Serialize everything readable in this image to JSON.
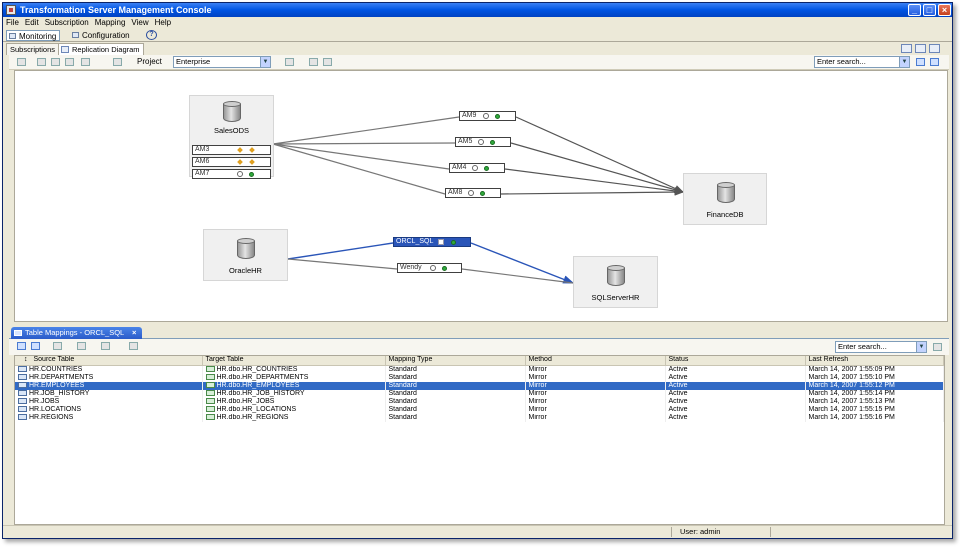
{
  "window": {
    "title": "Transformation Server Management Console"
  },
  "menu": [
    "File",
    "Edit",
    "Subscription",
    "Mapping",
    "View",
    "Help"
  ],
  "perspectives": [
    {
      "label": "Monitoring",
      "active": true
    },
    {
      "label": "Configuration",
      "active": false
    }
  ],
  "view_tabs": [
    {
      "label": "Subscriptions",
      "active": false
    },
    {
      "label": "Replication Diagram",
      "active": true
    }
  ],
  "toolbar": {
    "project_label": "Project",
    "project_value": "Enterprise",
    "search_placeholder": "Enter search..."
  },
  "diagram": {
    "nodes": [
      {
        "id": "salesods",
        "label": "SalesODS"
      },
      {
        "id": "financedb",
        "label": "FinanceDB"
      },
      {
        "id": "oraclehr",
        "label": "OracleHR"
      },
      {
        "id": "sqlserverhr",
        "label": "SQLServerHR"
      }
    ],
    "source_subscriptions": [
      "AM3",
      "AM6",
      "AM7"
    ],
    "route_subscriptions": [
      "AM9",
      "AM5",
      "AM4",
      "AM8",
      "ORCL_SQL",
      "Wendy"
    ],
    "selected_subscription": "ORCL_SQL"
  },
  "table_mappings": {
    "tab_label": "Table Mappings - ORCL_SQL",
    "search_placeholder": "Enter search...",
    "columns": [
      "Source Table",
      "Target Table",
      "Mapping Type",
      "Method",
      "Status",
      "Last Refresh"
    ],
    "rows": [
      [
        "HR.COUNTRIES",
        "HR.dbo.HR_COUNTRIES",
        "Standard",
        "Mirror",
        "Active",
        "March 14, 2007 1:55:09 PM"
      ],
      [
        "HR.DEPARTMENTS",
        "HR.dbo.HR_DEPARTMENTS",
        "Standard",
        "Mirror",
        "Active",
        "March 14, 2007 1:55:10 PM"
      ],
      [
        "HR.EMPLOYEES",
        "HR.dbo.HR_EMPLOYEES",
        "Standard",
        "Mirror",
        "Active",
        "March 14, 2007 1:55:12 PM"
      ],
      [
        "HR.JOB_HISTORY",
        "HR.dbo.HR_JOB_HISTORY",
        "Standard",
        "Mirror",
        "Active",
        "March 14, 2007 1:55:14 PM"
      ],
      [
        "HR.JOBS",
        "HR.dbo.HR_JOBS",
        "Standard",
        "Mirror",
        "Active",
        "March 14, 2007 1:55:13 PM"
      ],
      [
        "HR.LOCATIONS",
        "HR.dbo.HR_LOCATIONS",
        "Standard",
        "Mirror",
        "Active",
        "March 14, 2007 1:55:15 PM"
      ],
      [
        "HR.REGIONS",
        "HR.dbo.HR_REGIONS",
        "Standard",
        "Mirror",
        "Active",
        "March 14, 2007 1:55:16 PM"
      ]
    ],
    "selected_row": 2
  },
  "status": {
    "user": "User: admin"
  },
  "colors": {
    "titlebar": "#0054e3",
    "selection": "#316ac5",
    "subscription_selected": "#2a55b8",
    "active_status": "#2faa3c"
  }
}
